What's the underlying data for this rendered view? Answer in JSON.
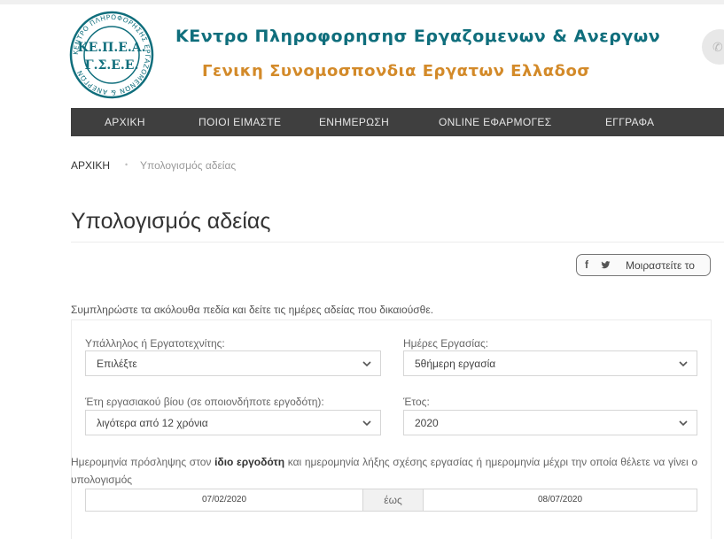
{
  "header": {
    "logo": {
      "ring_text": "ΚΕΝΤΡΟ ΠΛΗΡΟΦΟΡΗΣΗΣ ΕΡΓΑΖΟΜΕΝΩΝ & ΑΝΕΡΓΩΝ",
      "line1": "ΚΕ.Π.Ε.Α.",
      "line2": "Γ.Σ.Ε.Ε."
    },
    "title_main": "ΚΕντρο Πληροφορησησ Εργαζομενων & Ανεργων",
    "title_sub": "Γενικη Συνομοσπονδια Εργατων Ελλαδοσ",
    "phone_icon": "phone-icon",
    "colors": {
      "main": "#0f6e7c",
      "sub": "#d38a29",
      "nav_bg": "#3f3f3f"
    }
  },
  "nav": {
    "items": [
      "ΑΡΧΙΚΗ",
      "ΠΟΙΟΙ ΕΙΜΑΣΤΕ",
      "ΕΝΗΜΕΡΩΣΗ",
      "ONLINE ΕΦΑΡΜΟΓΕΣ",
      "ΕΓΓΡΑΦΑ"
    ]
  },
  "breadcrumb": {
    "home": "ΑΡΧΙΚΗ",
    "separator": "•",
    "current": "Υπολογισμός αδείας"
  },
  "page": {
    "title": "Υπολογισμός αδείας"
  },
  "share": {
    "facebook_icon": "f",
    "twitter_icon": "twitter-icon",
    "label": "Μοιραστείτε το"
  },
  "form": {
    "intro": "Συμπληρώστε τα ακόλουθα πεδία και δείτε τις ημέρες αδείας που δικαιούσθε.",
    "employee_type": {
      "label": "Υπάλληλος ή Εργατοτεχνίτης:",
      "value": "Επιλέξτε"
    },
    "work_days": {
      "label": "Ημέρες Εργασίας:",
      "value": "5θήμερη εργασία"
    },
    "years_worked": {
      "label": "Έτη εργασιακού βίου (σε οποιονδήποτε εργοδότη):",
      "value": "λιγότερα από 12 χρόνια"
    },
    "year": {
      "label": "Έτος:",
      "value": "2020"
    },
    "dates_text_pre": "Ημερομηνία πρόσληψης στον",
    "dates_text_bold": "ίδιο εργοδότη",
    "dates_text_post": "και ημερομηνία λήξης σχέσης εργασίας ή ημερομηνία μέχρι την οποία θέλετε να γίνει ο υπολογισμός",
    "date_from": "07/02/2020",
    "date_sep": "έως",
    "date_to": "08/07/2020"
  }
}
